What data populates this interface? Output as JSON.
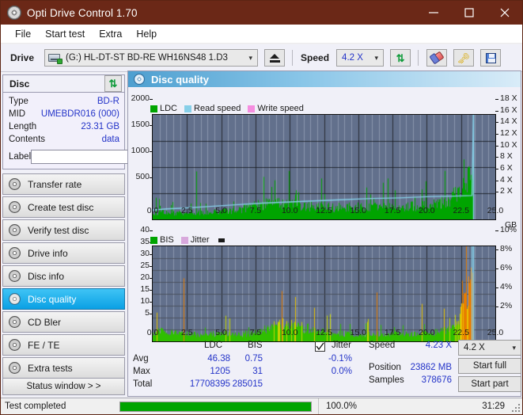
{
  "window": {
    "title": "Opti Drive Control 1.70",
    "icon": "disc-icon",
    "minimize": "−",
    "maximize": "□",
    "close": "×",
    "titlebar_color": "#6b2817"
  },
  "menu": {
    "items": [
      {
        "label": "File"
      },
      {
        "label": "Start test"
      },
      {
        "label": "Extra"
      },
      {
        "label": "Help"
      }
    ]
  },
  "toolbar": {
    "drive_label": "Drive",
    "drive_value": "(G:)  HL-DT-ST BD-RE  WH16NS48 1.D3",
    "drive_icon": "optical-drive-icon",
    "eject_icon": "eject-icon",
    "speed_label": "Speed",
    "speed_value": "4.2 X",
    "refresh_icon": "refresh-icon",
    "erase_icon": "eraser-icon",
    "keys_icon": "keys-icon",
    "save_icon": "floppy-save-icon"
  },
  "disc_panel": {
    "header": "Disc",
    "refresh_icon": "refresh-icon",
    "rows": [
      {
        "label": "Type",
        "value": "BD-R"
      },
      {
        "label": "MID",
        "value": "UMEBDR016 (000)"
      },
      {
        "label": "Length",
        "value": "23.31 GB"
      },
      {
        "label": "Contents",
        "value": "data"
      }
    ],
    "label_field_label": "Label",
    "label_field_value": "",
    "label_field_placeholder": "",
    "disc_icon": "compact-disc-icon"
  },
  "nav": {
    "items": [
      {
        "label": "Transfer rate",
        "icon": "disc-icon",
        "active": false
      },
      {
        "label": "Create test disc",
        "icon": "disc-icon",
        "active": false
      },
      {
        "label": "Verify test disc",
        "icon": "disc-icon",
        "active": false
      },
      {
        "label": "Drive info",
        "icon": "disc-icon",
        "active": false
      },
      {
        "label": "Disc info",
        "icon": "disc-icon",
        "active": false
      },
      {
        "label": "Disc quality",
        "icon": "disc-icon",
        "active": true
      },
      {
        "label": "CD Bler",
        "icon": "disc-icon",
        "active": false
      },
      {
        "label": "FE / TE",
        "icon": "disc-icon",
        "active": false
      },
      {
        "label": "Extra tests",
        "icon": "disc-icon",
        "active": false
      }
    ],
    "status_window": "Status window > >",
    "active_color": "#0aa0e4"
  },
  "panel": {
    "title": "Disc quality",
    "icon": "disc-quality-icon"
  },
  "stats": {
    "col_ldc": "LDC",
    "col_bis": "BIS",
    "row_avg": "Avg",
    "row_max": "Max",
    "row_total": "Total",
    "avg_ldc": "46.38",
    "avg_bis": "0.75",
    "max_ldc": "1205",
    "max_bis": "31",
    "total_ldc": "17708395",
    "total_bis": "285015",
    "jitter_label": "Jitter",
    "jitter_checked": true,
    "jitter_avg": "-0.1%",
    "jitter_max": "0.0%",
    "speed_label": "Speed",
    "speed_value": "4.23 X",
    "position_label": "Position",
    "position_value": "23862 MB",
    "samples_label": "Samples",
    "samples_value": "378676",
    "speed_select": "4.2 X",
    "start_full": "Start full",
    "start_part": "Start part"
  },
  "statusbar": {
    "message": "Test completed",
    "progress_percent": 100.0,
    "progress_text": "100.0%",
    "elapsed": "31:29"
  },
  "chart_data": [
    {
      "id": "ldc-chart",
      "type": "area",
      "title": "",
      "xlabel": "GB",
      "ylabel": "",
      "xlim": [
        0,
        25
      ],
      "ylim": [
        0,
        2000
      ],
      "y2lim": [
        0,
        18
      ],
      "grid": true,
      "legend_position": "top-left",
      "legend": [
        {
          "name": "LDC",
          "color": "#00a400"
        },
        {
          "name": "Read speed",
          "color": "#87cfe8"
        },
        {
          "name": "Write speed",
          "color": "#f58ee0"
        }
      ],
      "xticks": [
        "0.0",
        "2.5",
        "5.0",
        "7.5",
        "10.0",
        "12.5",
        "15.0",
        "17.5",
        "20.0",
        "22.5",
        "25.0"
      ],
      "yticks": [
        "500",
        "1000",
        "1500",
        "2000"
      ],
      "y2ticks": [
        "2 X",
        "4 X",
        "6 X",
        "8 X",
        "10 X",
        "12 X",
        "14 X",
        "16 X",
        "18 X"
      ],
      "data_end_gb": 23.4,
      "series": [
        {
          "name": "LDC",
          "color": "#00a400",
          "kind": "spikes",
          "x_start": 0.0,
          "x_end": 23.4,
          "baseline": [
            120,
            150,
            140,
            130,
            125,
            130,
            135,
            140,
            150,
            160,
            170,
            180,
            200,
            230,
            270,
            300,
            320,
            330,
            320,
            300,
            290,
            280,
            270,
            260,
            255,
            250,
            245,
            250,
            255,
            260,
            265,
            260,
            255,
            250,
            245,
            250,
            260,
            270,
            280,
            300,
            330,
            380,
            460,
            620,
            900,
            1205
          ],
          "noise": 220,
          "spike_max": 1205
        },
        {
          "name": "Read speed",
          "color": "#87cfe8",
          "kind": "line",
          "points_x": [
            0.0,
            1.0,
            2.0,
            4.0,
            6.0,
            8.0,
            10.0,
            12.0,
            14.0,
            16.0,
            18.0,
            20.0,
            22.0,
            23.3,
            23.4
          ],
          "points_y_x": [
            1.6,
            1.8,
            1.9,
            2.2,
            2.5,
            2.8,
            3.0,
            3.2,
            3.4,
            3.6,
            3.7,
            3.9,
            4.0,
            4.1,
            18.0
          ]
        }
      ]
    },
    {
      "id": "bis-chart",
      "type": "area",
      "title": "",
      "xlabel": "GB",
      "ylabel": "",
      "xlim": [
        0,
        25
      ],
      "ylim": [
        0,
        40
      ],
      "y2lim": [
        0,
        10
      ],
      "grid": true,
      "legend_position": "top-left",
      "legend": [
        {
          "name": "BIS",
          "color": "#00a400"
        },
        {
          "name": "Jitter",
          "color": "#d8a8dc"
        }
      ],
      "xticks": [
        "0.0",
        "2.5",
        "5.0",
        "7.5",
        "10.0",
        "12.5",
        "15.0",
        "17.5",
        "20.0",
        "22.5",
        "25.0"
      ],
      "yticks": [
        "5",
        "10",
        "15",
        "20",
        "25",
        "30",
        "35",
        "40"
      ],
      "y2ticks": [
        "2%",
        "4%",
        "6%",
        "8%",
        "10%"
      ],
      "data_end_gb": 23.4,
      "series": [
        {
          "name": "BIS",
          "color": "#00a400",
          "kind": "spikes",
          "x_start": 0.0,
          "x_end": 23.4,
          "baseline": [
            4.0,
            4.5,
            4.0,
            3.6,
            3.4,
            3.3,
            3.2,
            3.2,
            3.3,
            3.4,
            3.4,
            3.3,
            3.2,
            3.3,
            3.6,
            4.4,
            5.6,
            6.8,
            7.6,
            7.8,
            7.2,
            6.4,
            5.6,
            5.0,
            4.4,
            4.0,
            3.7,
            3.5,
            3.4,
            3.3,
            3.3,
            3.2,
            3.2,
            3.3,
            3.3,
            3.4,
            3.4,
            3.5,
            3.6,
            3.8,
            4.2,
            5.0,
            7.0,
            12.0,
            20.0,
            31.0
          ],
          "noise": 6.0,
          "spike_max": 31
        },
        {
          "name": "Jitter",
          "color": "#d8a8dc",
          "kind": "line",
          "points_x": [
            23.3,
            23.4
          ],
          "points_y_pct": [
            9.0,
            10.0
          ]
        }
      ]
    }
  ]
}
